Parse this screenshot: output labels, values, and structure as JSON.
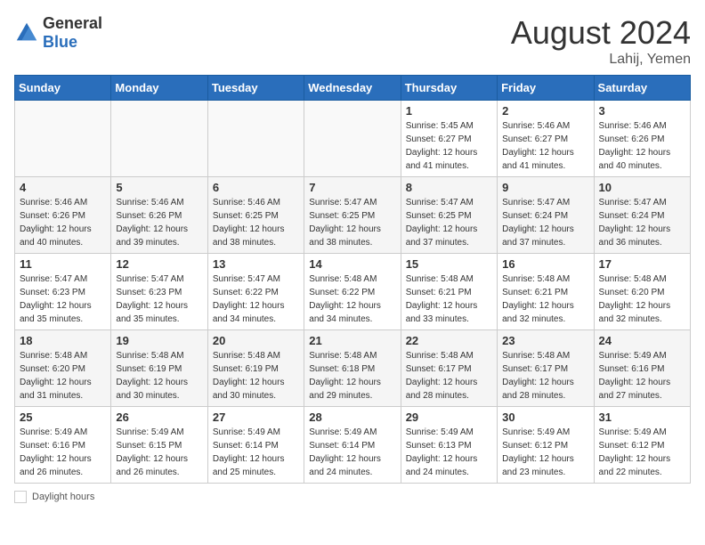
{
  "header": {
    "logo_general": "General",
    "logo_blue": "Blue",
    "month_year": "August 2024",
    "location": "Lahij, Yemen"
  },
  "footer": {
    "daylight_label": "Daylight hours"
  },
  "days_of_week": [
    "Sunday",
    "Monday",
    "Tuesday",
    "Wednesday",
    "Thursday",
    "Friday",
    "Saturday"
  ],
  "weeks": [
    [
      {
        "day": "",
        "info": ""
      },
      {
        "day": "",
        "info": ""
      },
      {
        "day": "",
        "info": ""
      },
      {
        "day": "",
        "info": ""
      },
      {
        "day": "1",
        "info": "Sunrise: 5:45 AM\nSunset: 6:27 PM\nDaylight: 12 hours\nand 41 minutes."
      },
      {
        "day": "2",
        "info": "Sunrise: 5:46 AM\nSunset: 6:27 PM\nDaylight: 12 hours\nand 41 minutes."
      },
      {
        "day": "3",
        "info": "Sunrise: 5:46 AM\nSunset: 6:26 PM\nDaylight: 12 hours\nand 40 minutes."
      }
    ],
    [
      {
        "day": "4",
        "info": "Sunrise: 5:46 AM\nSunset: 6:26 PM\nDaylight: 12 hours\nand 40 minutes."
      },
      {
        "day": "5",
        "info": "Sunrise: 5:46 AM\nSunset: 6:26 PM\nDaylight: 12 hours\nand 39 minutes."
      },
      {
        "day": "6",
        "info": "Sunrise: 5:46 AM\nSunset: 6:25 PM\nDaylight: 12 hours\nand 38 minutes."
      },
      {
        "day": "7",
        "info": "Sunrise: 5:47 AM\nSunset: 6:25 PM\nDaylight: 12 hours\nand 38 minutes."
      },
      {
        "day": "8",
        "info": "Sunrise: 5:47 AM\nSunset: 6:25 PM\nDaylight: 12 hours\nand 37 minutes."
      },
      {
        "day": "9",
        "info": "Sunrise: 5:47 AM\nSunset: 6:24 PM\nDaylight: 12 hours\nand 37 minutes."
      },
      {
        "day": "10",
        "info": "Sunrise: 5:47 AM\nSunset: 6:24 PM\nDaylight: 12 hours\nand 36 minutes."
      }
    ],
    [
      {
        "day": "11",
        "info": "Sunrise: 5:47 AM\nSunset: 6:23 PM\nDaylight: 12 hours\nand 35 minutes."
      },
      {
        "day": "12",
        "info": "Sunrise: 5:47 AM\nSunset: 6:23 PM\nDaylight: 12 hours\nand 35 minutes."
      },
      {
        "day": "13",
        "info": "Sunrise: 5:47 AM\nSunset: 6:22 PM\nDaylight: 12 hours\nand 34 minutes."
      },
      {
        "day": "14",
        "info": "Sunrise: 5:48 AM\nSunset: 6:22 PM\nDaylight: 12 hours\nand 34 minutes."
      },
      {
        "day": "15",
        "info": "Sunrise: 5:48 AM\nSunset: 6:21 PM\nDaylight: 12 hours\nand 33 minutes."
      },
      {
        "day": "16",
        "info": "Sunrise: 5:48 AM\nSunset: 6:21 PM\nDaylight: 12 hours\nand 32 minutes."
      },
      {
        "day": "17",
        "info": "Sunrise: 5:48 AM\nSunset: 6:20 PM\nDaylight: 12 hours\nand 32 minutes."
      }
    ],
    [
      {
        "day": "18",
        "info": "Sunrise: 5:48 AM\nSunset: 6:20 PM\nDaylight: 12 hours\nand 31 minutes."
      },
      {
        "day": "19",
        "info": "Sunrise: 5:48 AM\nSunset: 6:19 PM\nDaylight: 12 hours\nand 30 minutes."
      },
      {
        "day": "20",
        "info": "Sunrise: 5:48 AM\nSunset: 6:19 PM\nDaylight: 12 hours\nand 30 minutes."
      },
      {
        "day": "21",
        "info": "Sunrise: 5:48 AM\nSunset: 6:18 PM\nDaylight: 12 hours\nand 29 minutes."
      },
      {
        "day": "22",
        "info": "Sunrise: 5:48 AM\nSunset: 6:17 PM\nDaylight: 12 hours\nand 28 minutes."
      },
      {
        "day": "23",
        "info": "Sunrise: 5:48 AM\nSunset: 6:17 PM\nDaylight: 12 hours\nand 28 minutes."
      },
      {
        "day": "24",
        "info": "Sunrise: 5:49 AM\nSunset: 6:16 PM\nDaylight: 12 hours\nand 27 minutes."
      }
    ],
    [
      {
        "day": "25",
        "info": "Sunrise: 5:49 AM\nSunset: 6:16 PM\nDaylight: 12 hours\nand 26 minutes."
      },
      {
        "day": "26",
        "info": "Sunrise: 5:49 AM\nSunset: 6:15 PM\nDaylight: 12 hours\nand 26 minutes."
      },
      {
        "day": "27",
        "info": "Sunrise: 5:49 AM\nSunset: 6:14 PM\nDaylight: 12 hours\nand 25 minutes."
      },
      {
        "day": "28",
        "info": "Sunrise: 5:49 AM\nSunset: 6:14 PM\nDaylight: 12 hours\nand 24 minutes."
      },
      {
        "day": "29",
        "info": "Sunrise: 5:49 AM\nSunset: 6:13 PM\nDaylight: 12 hours\nand 24 minutes."
      },
      {
        "day": "30",
        "info": "Sunrise: 5:49 AM\nSunset: 6:12 PM\nDaylight: 12 hours\nand 23 minutes."
      },
      {
        "day": "31",
        "info": "Sunrise: 5:49 AM\nSunset: 6:12 PM\nDaylight: 12 hours\nand 22 minutes."
      }
    ]
  ]
}
